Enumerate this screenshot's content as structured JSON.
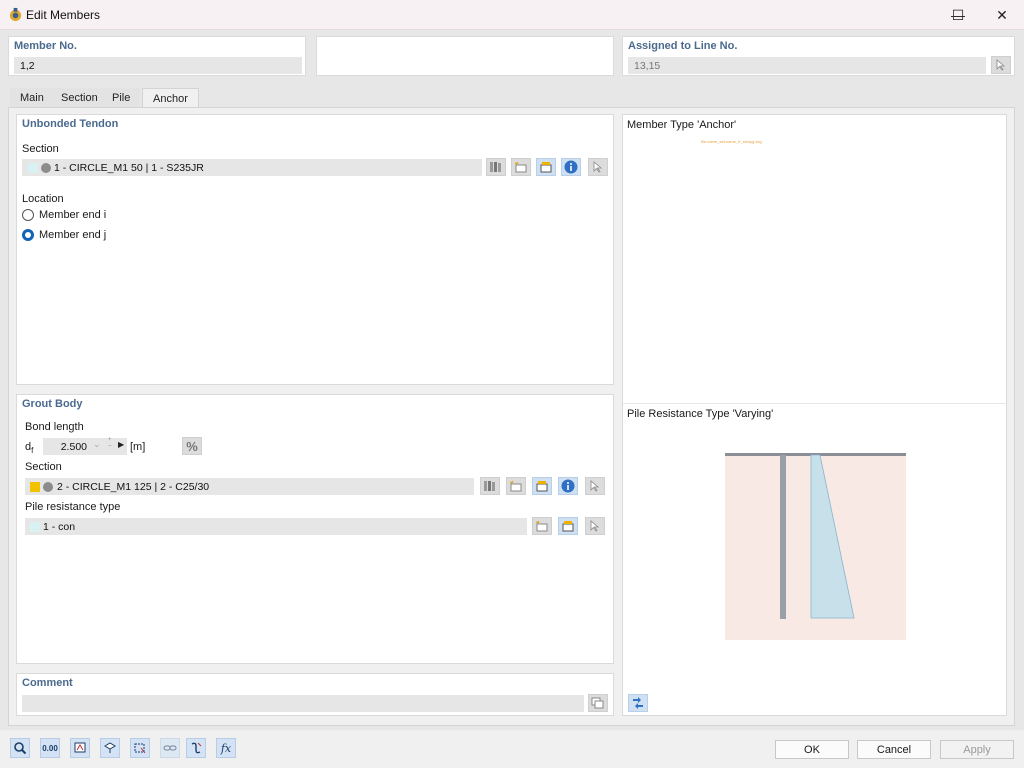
{
  "window": {
    "title": "Edit Members",
    "minimize": "—",
    "maximize": "☐",
    "close": "✕"
  },
  "header": {
    "member_no_label": "Member No.",
    "member_no_value": "1,2",
    "assigned_label": "Assigned to Line No.",
    "assigned_value": "13,15"
  },
  "tabs": [
    {
      "label": "Main"
    },
    {
      "label": "Section"
    },
    {
      "label": "Pile"
    },
    {
      "label": "Anchor",
      "active": true
    }
  ],
  "unbonded": {
    "title": "Unbonded Tendon",
    "section_label": "Section",
    "section_value": "1 - CIRCLE_M1 50 | 1 - S235JR",
    "section_color": "#d8f2f4",
    "location_label": "Location",
    "options": [
      "Member end i",
      "Member end j"
    ],
    "selected": "Member end j"
  },
  "grout": {
    "title": "Grout Body",
    "bond_label": "Bond length",
    "bond_symbol": "d",
    "bond_sub": "f",
    "bond_value": "2.500",
    "bond_unit": "[m]",
    "percent": "%",
    "section_label": "Section",
    "section_value": "2 - CIRCLE_M1 125 | 2 - C25/30",
    "section_color": "#f2c200",
    "pile_label": "Pile resistance type",
    "pile_value": "1 - con",
    "pile_color": "#d8f2f4"
  },
  "comment": {
    "title": "Comment",
    "value": ""
  },
  "preview": {
    "anchor_title": "Member Type 'Anchor'",
    "anchor_caption": "file:name_set:name_fr_strwyg.svg",
    "pile_title": "Pile Resistance Type 'Varying'"
  },
  "buttons": {
    "ok": "OK",
    "cancel": "Cancel",
    "apply": "Apply"
  },
  "colors": {
    "header_text": "#4a6a8e",
    "accent_blue": "#1463b8",
    "diagram_fill": "#c8e0ea",
    "diagram_bg": "#f8e9e4"
  }
}
